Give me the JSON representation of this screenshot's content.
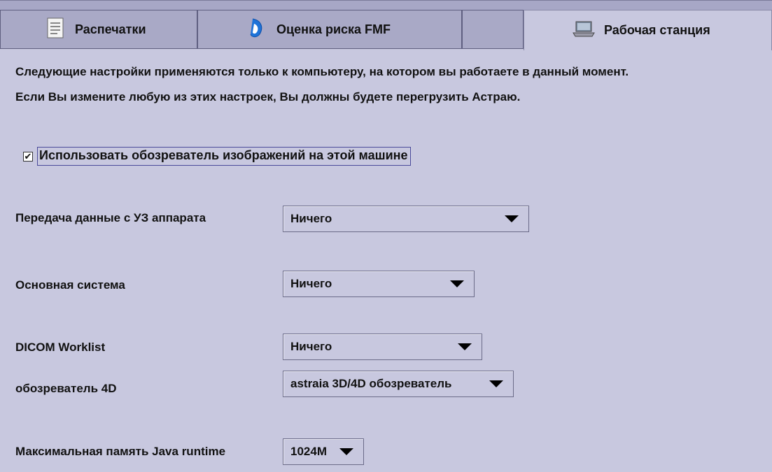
{
  "tabs": [
    {
      "label": "Распечатки",
      "icon": "document-icon",
      "selected": false
    },
    {
      "label": "Оценка риска FMF",
      "icon": "fmf-risk-icon",
      "selected": false
    },
    {
      "label": "",
      "icon": "",
      "selected": false
    },
    {
      "label": "Рабочая станция",
      "icon": "workstation-icon",
      "selected": true
    }
  ],
  "intro": {
    "line1": "Следующие настройки применяются только к компьютеру, на котором вы работаете в данный момент.",
    "line2": "Если Вы измените любую из этих настроек, Вы должны будете перегрузить Астраю."
  },
  "image_viewer": {
    "label": "Использовать обозреватель изображений на этой машине",
    "checked": true,
    "check_mark": "✔"
  },
  "fields": {
    "us_transfer": {
      "label": "Передача данные с УЗ аппарата",
      "value": "Ничего"
    },
    "main_system": {
      "label": "Основная система",
      "value": "Ничего"
    },
    "dicom_worklist": {
      "label": "DICOM Worklist",
      "value": "Ничего"
    },
    "viewer_4d": {
      "label": "обозреватель 4D",
      "value": "astraia 3D/4D обозреватель"
    },
    "java_memory": {
      "label": "Максимальная память Java runtime",
      "value": "1024M"
    }
  }
}
